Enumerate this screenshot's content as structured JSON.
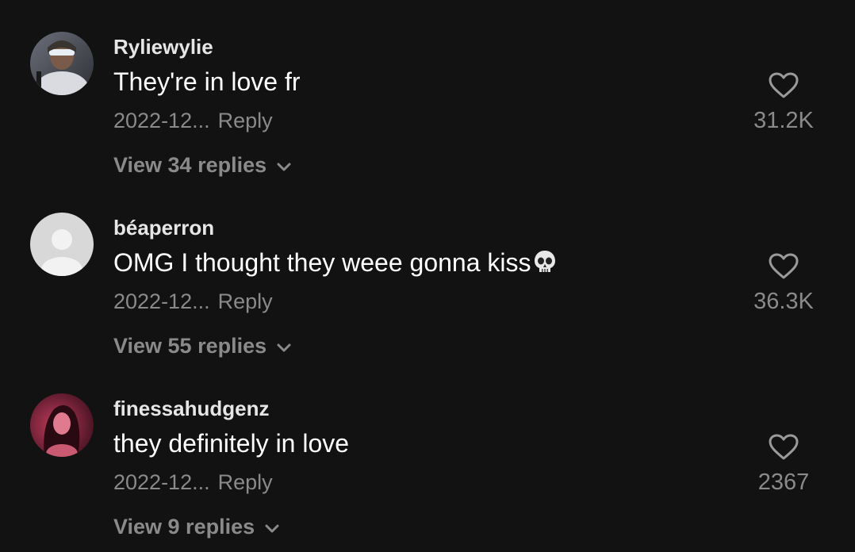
{
  "comments": [
    {
      "username": "Ryliewylie",
      "text": "They're in love fr",
      "date": "2022-12...",
      "reply_label": "Reply",
      "view_replies": "View 34 replies",
      "likes": "31.2K",
      "avatar": "user-photo"
    },
    {
      "username": "béaperron",
      "text": "OMG I thought they weee gonna kiss",
      "emoji": "skull-emoji",
      "date": "2022-12...",
      "reply_label": "Reply",
      "view_replies": "View 55 replies",
      "likes": "36.3K",
      "avatar": "default-avatar"
    },
    {
      "username": "finessahudgenz",
      "text": "they definitely in love",
      "date": "2022-12...",
      "reply_label": "Reply",
      "view_replies": "View 9 replies",
      "likes": "2367",
      "avatar": "user-photo"
    }
  ],
  "colors": {
    "background": "#121212",
    "primary_text": "#ffffff",
    "secondary_text": "#8a8a8a"
  }
}
